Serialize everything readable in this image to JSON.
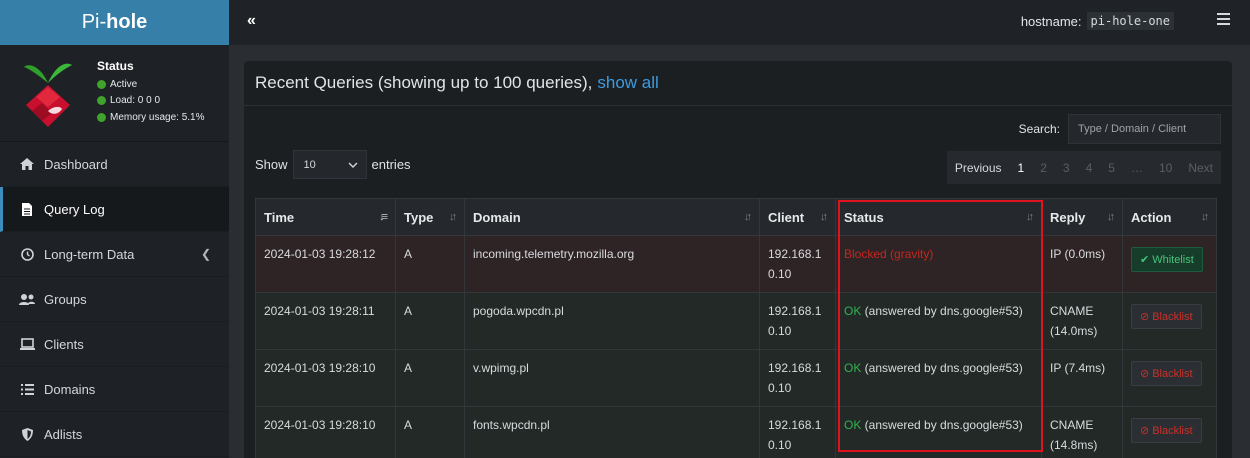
{
  "logo": {
    "thin": "Pi-",
    "bold": "hole"
  },
  "status": {
    "title": "Status",
    "active": "Active",
    "load": "Load:  0  0  0",
    "memory": "Memory usage:  5.1%"
  },
  "nav": [
    {
      "label": "Dashboard",
      "icon": "home-icon"
    },
    {
      "label": "Query Log",
      "icon": "file-icon"
    },
    {
      "label": "Long-term Data",
      "icon": "history-icon"
    },
    {
      "label": "Groups",
      "icon": "users-icon"
    },
    {
      "label": "Clients",
      "icon": "laptop-icon"
    },
    {
      "label": "Domains",
      "icon": "list-icon"
    },
    {
      "label": "Adlists",
      "icon": "shield-icon"
    }
  ],
  "topbar": {
    "collapse": "«",
    "hostname_label": "hostname:",
    "hostname_value": "pi-hole-one"
  },
  "box": {
    "title": "Recent Queries (showing up to 100 queries),",
    "show_all": "show all"
  },
  "search": {
    "label": "Search:",
    "placeholder": "Type / Domain / Client"
  },
  "length": {
    "show": "Show",
    "value": "10",
    "entries": "entries"
  },
  "pager": {
    "previous": "Previous",
    "pages": [
      "1",
      "2",
      "3",
      "4",
      "5",
      "…",
      "10"
    ],
    "next": "Next"
  },
  "columns": [
    "Time",
    "Type",
    "Domain",
    "Client",
    "Status",
    "Reply",
    "Action"
  ],
  "rows": [
    {
      "time": "2024-01-03 19:28:12",
      "type": "A",
      "domain": "incoming.telemetry.mozilla.org",
      "client1": "192.168.1",
      "client2": "0.10",
      "status_main": "Blocked (gravity)",
      "status_rest": "",
      "reply1": "IP (0.0ms)",
      "reply2": "",
      "action": "Whitelist"
    },
    {
      "time": "2024-01-03 19:28:11",
      "type": "A",
      "domain": "pogoda.wpcdn.pl",
      "client1": "192.168.1",
      "client2": "0.10",
      "status_main": "OK",
      "status_rest": " (answered by dns.google#53)",
      "reply1": "CNAME",
      "reply2": "(14.0ms)",
      "action": "Blacklist"
    },
    {
      "time": "2024-01-03 19:28:10",
      "type": "A",
      "domain": "v.wpimg.pl",
      "client1": "192.168.1",
      "client2": "0.10",
      "status_main": "OK",
      "status_rest": " (answered by dns.google#53)",
      "reply1": "IP (7.4ms)",
      "reply2": "",
      "action": "Blacklist"
    },
    {
      "time": "2024-01-03 19:28:10",
      "type": "A",
      "domain": "fonts.wpcdn.pl",
      "client1": "192.168.1",
      "client2": "0.10",
      "status_main": "OK",
      "status_rest": " (answered by dns.google#53)",
      "reply1": "CNAME",
      "reply2": "(14.8ms)",
      "action": "Blacklist"
    }
  ],
  "colors": {
    "accent": "#367fa9",
    "blocked": "#c3261f",
    "ok": "#2fb351",
    "highlight": "#e0121d"
  }
}
